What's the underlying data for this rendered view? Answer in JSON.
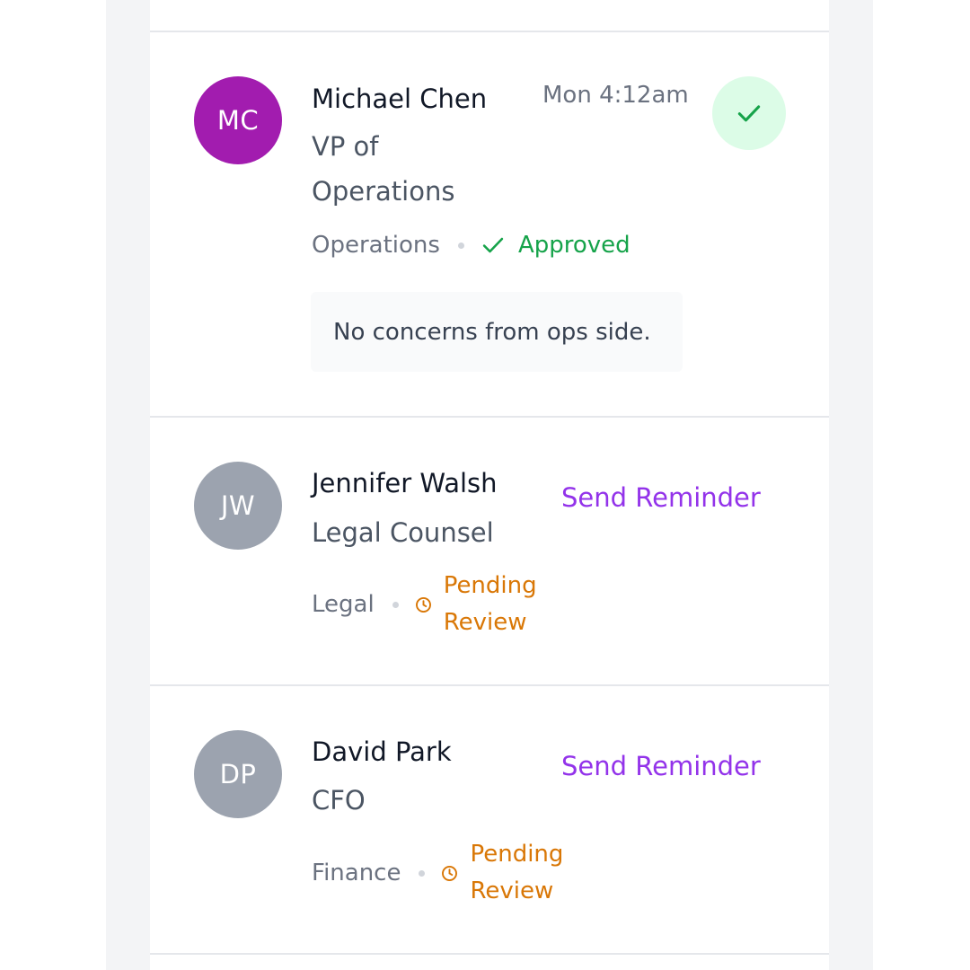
{
  "colors": {
    "accent": "#9333ea",
    "approved": "#16a34a",
    "pending": "#d97706",
    "avatar_active": "#a21caf",
    "avatar_inactive": "#9ca3af"
  },
  "approvers": [
    {
      "initials": "MC",
      "name": "Michael Chen",
      "role": "VP of Operations",
      "department": "Operations",
      "status": "Approved",
      "status_icon": "check-icon",
      "timestamp": "Mon 4:12am",
      "comment": "No concerns from ops side."
    },
    {
      "initials": "JW",
      "name": "Jennifer Walsh",
      "role": "Legal Counsel",
      "department": "Legal",
      "status": "Pending Review",
      "status_icon": "clock-icon",
      "action_label": "Send Reminder"
    },
    {
      "initials": "DP",
      "name": "David Park",
      "role": "CFO",
      "department": "Finance",
      "status": "Pending Review",
      "status_icon": "clock-icon",
      "action_label": "Send Reminder"
    }
  ]
}
